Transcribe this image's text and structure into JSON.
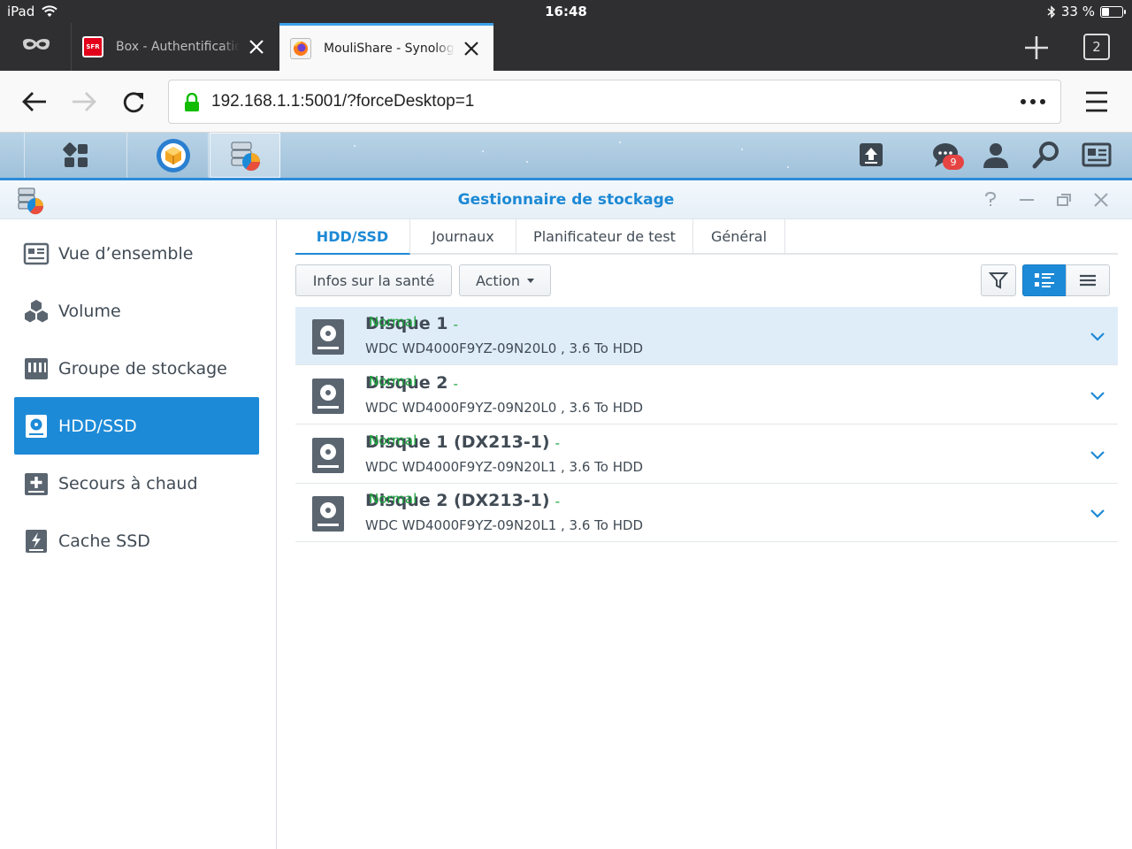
{
  "status_bar": {
    "device": "iPad",
    "time": "16:48",
    "battery": "33 %",
    "battery_level": 0.33
  },
  "browser": {
    "tabs": [
      {
        "title": "Box - Authentification",
        "favicon": "SFR",
        "active": false
      },
      {
        "title": "MouliShare - Synology",
        "active": true
      }
    ],
    "tab_count": "2",
    "url": "192.168.1.1:5001/?forceDesktop=1"
  },
  "dsm": {
    "notification_count": "9"
  },
  "window": {
    "title": "Gestionnaire de stockage"
  },
  "sidebar": {
    "items": [
      {
        "label": "Vue d’ensemble",
        "icon": "overview-icon",
        "active": false
      },
      {
        "label": "Volume",
        "icon": "volume-icon",
        "active": false
      },
      {
        "label": "Groupe de stockage",
        "icon": "storage-pool-icon",
        "active": false
      },
      {
        "label": "HDD/SSD",
        "icon": "hdd-icon",
        "active": true
      },
      {
        "label": "Secours à chaud",
        "icon": "hot-spare-icon",
        "active": false
      },
      {
        "label": "Cache SSD",
        "icon": "ssd-cache-icon",
        "active": false
      }
    ]
  },
  "main": {
    "tabs": [
      {
        "label": "HDD/SSD",
        "active": true
      },
      {
        "label": "Journaux",
        "active": false
      },
      {
        "label": "Planificateur de test",
        "active": false
      },
      {
        "label": "Général",
        "active": false
      }
    ],
    "toolbar": {
      "health_label": "Infos sur la santé",
      "action_label": "Action"
    },
    "disks": [
      {
        "name": "Disque 1",
        "separator": "-",
        "status": "Normal",
        "model": "WDC WD4000F9YZ-09N20L0 , 3.6 To HDD",
        "selected": true
      },
      {
        "name": "Disque 2",
        "separator": "-",
        "status": "Normal",
        "model": "WDC WD4000F9YZ-09N20L0 , 3.6 To HDD",
        "selected": false
      },
      {
        "name": "Disque 1 (DX213-1)",
        "separator": "-",
        "status": "Normal",
        "model": "WDC WD4000F9YZ-09N20L1 , 3.6 To HDD",
        "selected": false
      },
      {
        "name": "Disque 2 (DX213-1)",
        "separator": "-",
        "status": "Normal",
        "model": "WDC WD4000F9YZ-09N20L1 , 3.6 To HDD",
        "selected": false
      }
    ]
  },
  "colors": {
    "accent": "#1d89d5",
    "status_ok": "#19a53b",
    "browser_dark": "#2f2f31"
  }
}
